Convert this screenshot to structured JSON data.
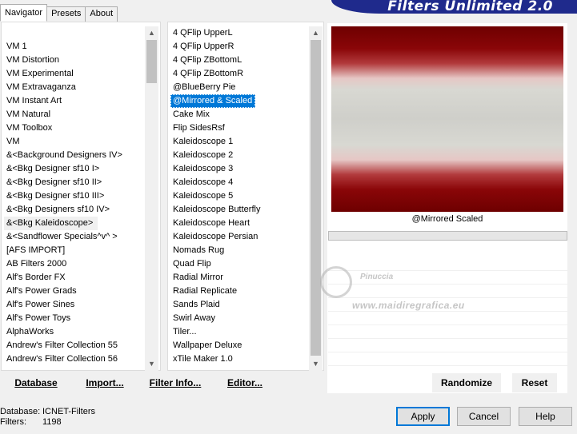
{
  "tabs": [
    {
      "label": "Navigator"
    },
    {
      "label": "Presets"
    },
    {
      "label": "About"
    }
  ],
  "banner": {
    "title": "Filters Unlimited 2.0"
  },
  "categories": [
    "VM 1",
    "VM Distortion",
    "VM Experimental",
    "VM Extravaganza",
    "VM Instant Art",
    "VM Natural",
    "VM Toolbox",
    "VM",
    "&<Background Designers IV>",
    "&<Bkg Designer sf10 I>",
    "&<Bkg Designer sf10 II>",
    "&<Bkg Designer sf10 III>",
    "&<Bkg Designers sf10 IV>",
    "&<Bkg Kaleidoscope>",
    "&<Sandflower Specials^v^ >",
    "[AFS IMPORT]",
    "AB Filters 2000",
    "Alf's Border FX",
    "Alf's Power Grads",
    "Alf's Power Sines",
    "Alf's Power Toys",
    "AlphaWorks",
    "Andrew's Filter Collection 55",
    "Andrew's Filter Collection 56"
  ],
  "filters": [
    "4 QFlip UpperL",
    "4 QFlip UpperR",
    "4 QFlip ZBottomL",
    "4 QFlip ZBottomR",
    "@BlueBerry Pie",
    "@Mirrored & Scaled",
    "Cake Mix",
    "Flip SidesRsf",
    "Kaleidoscope 1",
    "Kaleidoscope 2",
    "Kaleidoscope 3",
    "Kaleidoscope 4",
    "Kaleidoscope 5",
    "Kaleidoscope Butterfly",
    "Kaleidoscope Heart",
    "Kaleidoscope Persian",
    "Nomads Rug",
    "Quad Flip",
    "Radial Mirror",
    "Radial Replicate",
    "Sands Plaid",
    "Swirl Away",
    "Tiler...",
    "Wallpaper Deluxe",
    "xTile Maker 1.0"
  ],
  "preview": {
    "caption": "@Mirrored  Scaled"
  },
  "watermark": {
    "name": "Pinuccia",
    "url": "www.maidiregrafica.eu"
  },
  "links": {
    "database": "Database",
    "import": "Import...",
    "filter_info": "Filter Info...",
    "editor": "Editor...",
    "randomize": "Randomize",
    "reset": "Reset"
  },
  "status": {
    "database_label": "Database:",
    "database_value": "ICNET-Filters",
    "filters_label": "Filters:",
    "filters_value": "1198"
  },
  "buttons": {
    "apply": "Apply",
    "cancel": "Cancel",
    "help": "Help"
  },
  "colors": {
    "selection": "#0078d7",
    "banner": "#1f2a8c",
    "preview_red": "#8a0608"
  }
}
